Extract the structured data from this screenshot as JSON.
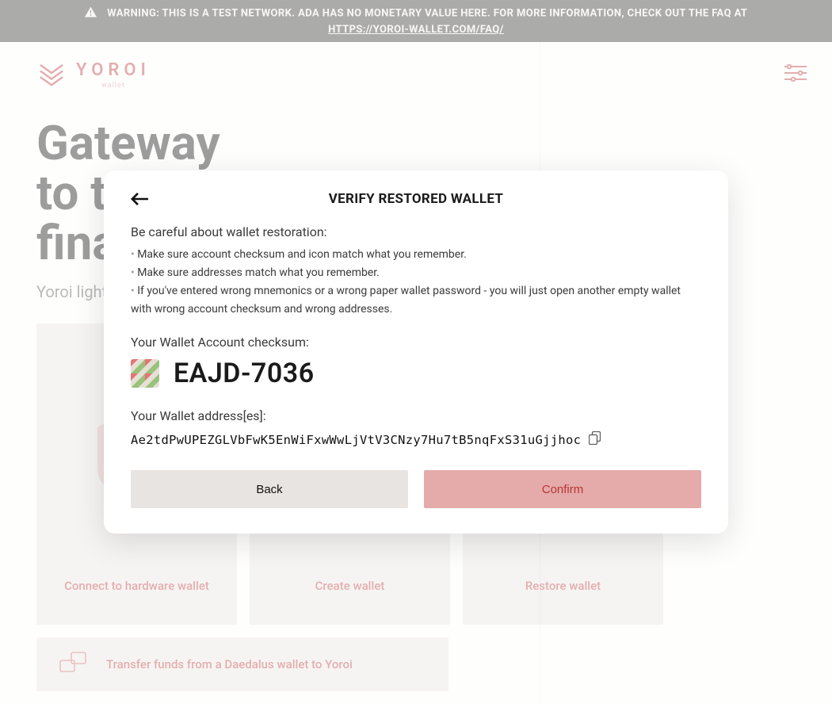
{
  "banner": {
    "text": "WARNING: THIS IS A TEST NETWORK. ADA HAS NO MONETARY VALUE HERE. FOR MORE INFORMATION, CHECK OUT THE FAQ AT",
    "link_text": "HTTPS://YOROI-WALLET.COM/FAQ/"
  },
  "logo": {
    "main": "YOROI",
    "sub": "wallet"
  },
  "hero": {
    "line1": "Gateway",
    "line2": "to the",
    "line3": "financial world",
    "subtitle": "Yoroi light wallet for Cardano assets"
  },
  "cards": {
    "connect_hw": "Connect to hardware wallet",
    "create": "Create wallet",
    "restore": "Restore wallet",
    "transfer": "Transfer funds from a Daedalus wallet to Yoroi"
  },
  "modal": {
    "title": "VERIFY RESTORED WALLET",
    "caution": "Be careful about wallet restoration:",
    "bullets": [
      "Make sure account checksum and icon match what you remember.",
      "Make sure addresses match what you remember.",
      "If you've entered wrong mnemonics or a wrong paper wallet password - you will just open another empty wallet with wrong account checksum and wrong addresses."
    ],
    "checksum_label": "Your Wallet Account checksum:",
    "checksum": "EAJD-7036",
    "address_label": "Your Wallet address[es]:",
    "address": "Ae2tdPwUPEZGLVbFwK5EnWiFxwWwLjVtV3CNzy7Hu7tB5nqFxS31uGjjhoc",
    "btn_back": "Back",
    "btn_confirm": "Confirm"
  }
}
